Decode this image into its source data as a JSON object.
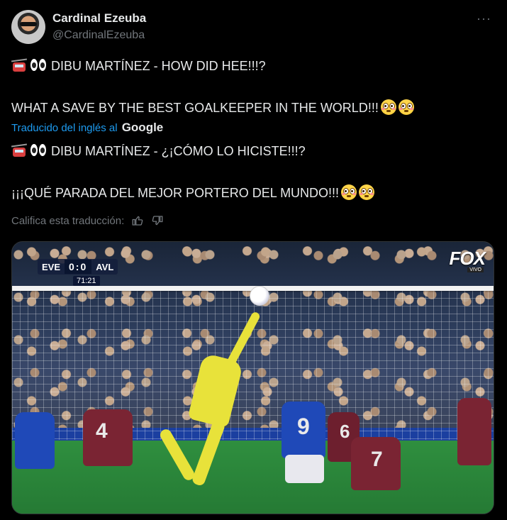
{
  "user": {
    "name": "Cardinal Ezeuba",
    "handle": "@CardinalEzeuba",
    "more": "···"
  },
  "tweet": {
    "line1": "DIBU MARTÍNEZ - HOW DID HEE!!!?",
    "line2": "WHAT A SAVE BY THE BEST GOALKEEPER IN THE WORLD!!!",
    "translated_by": "Traducido del inglés al",
    "translator": "Google",
    "line3": "DIBU MARTÍNEZ - ¿¡CÓMO LO HICISTE!!!?",
    "line4": "¡¡¡QUÉ PARADA DEL MEJOR PORTERO DEL MUNDO!!!",
    "rate_label": "Califica esta traducción:"
  },
  "video": {
    "home_team": "EVE",
    "score": "0:0",
    "away_team": "AVL",
    "clock": "71:21",
    "broadcaster": "FOX",
    "broadcaster_sub": "VIVO",
    "shirt_numbers": [
      "9",
      "4",
      "7",
      "6"
    ]
  },
  "colors": {
    "background": "#000000",
    "text": "#e7e9ea",
    "muted": "#71767b",
    "link": "#1d9bf0"
  }
}
